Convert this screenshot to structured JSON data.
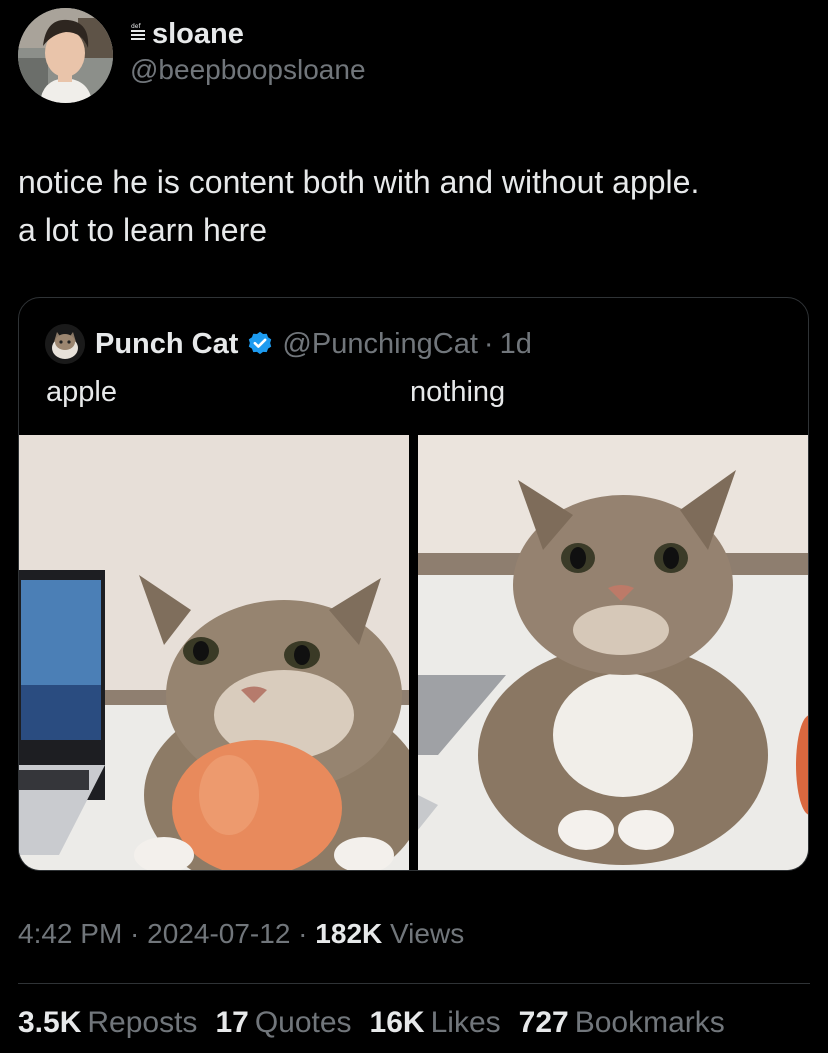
{
  "author": {
    "display_name": "sloane",
    "handle": "@beepboopsloane",
    "badge_text": "def"
  },
  "tweet": {
    "text": "notice he is content both with and without apple.\na lot to learn here"
  },
  "quote": {
    "display_name": "Punch Cat",
    "handle": "@PunchingCat",
    "separator": "·",
    "time": "1d",
    "caption_left": "apple",
    "caption_right": "nothing",
    "verified_color": "#1d9bf0"
  },
  "meta": {
    "time": "4:42 PM",
    "sep1": " · ",
    "date": "2024-07-12",
    "sep2": " · ",
    "views_count": "182K",
    "views_label": " Views"
  },
  "stats": {
    "reposts_count": "3.5K",
    "reposts_label": "Reposts",
    "quotes_count": "17",
    "quotes_label": "Quotes",
    "likes_count": "16K",
    "likes_label": "Likes",
    "bookmarks_count": "727",
    "bookmarks_label": "Bookmarks"
  }
}
